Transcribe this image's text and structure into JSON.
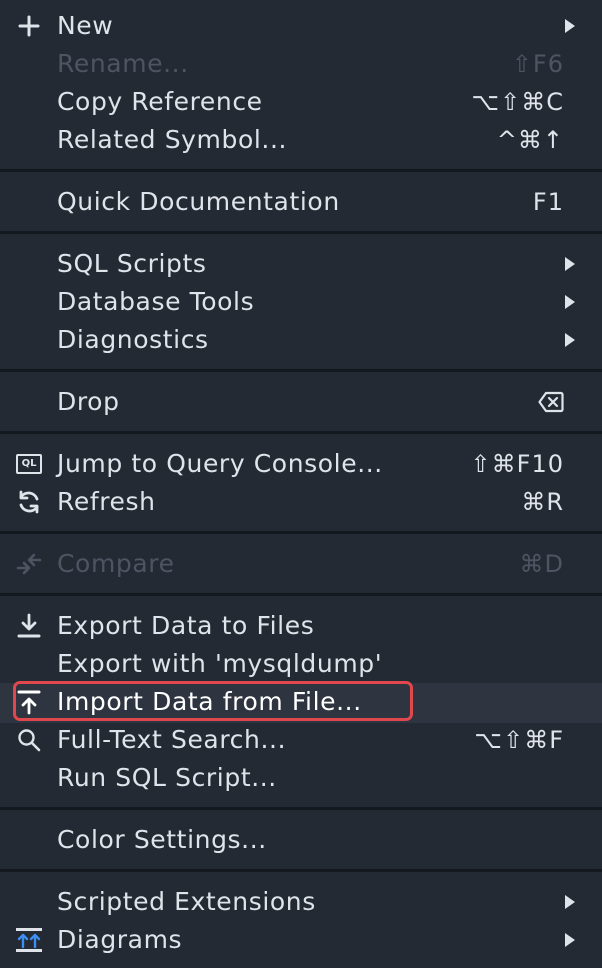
{
  "menu": {
    "new": {
      "label": "New"
    },
    "rename": {
      "label": "Rename...",
      "shortcut": "⇧F6"
    },
    "copy_reference": {
      "label": "Copy Reference",
      "shortcut": "⌥⇧⌘C"
    },
    "related_symbol": {
      "label": "Related Symbol...",
      "shortcut": "^⌘↑"
    },
    "quick_documentation": {
      "label": "Quick Documentation",
      "shortcut": "F1"
    },
    "sql_scripts": {
      "label": "SQL Scripts"
    },
    "database_tools": {
      "label": "Database Tools"
    },
    "diagnostics": {
      "label": "Diagnostics"
    },
    "drop": {
      "label": "Drop"
    },
    "jump_to_query_console": {
      "label": "Jump to Query Console...",
      "shortcut": "⇧⌘F10",
      "icon_text": "QL"
    },
    "refresh": {
      "label": "Refresh",
      "shortcut": "⌘R"
    },
    "compare": {
      "label": "Compare",
      "shortcut": "⌘D"
    },
    "export_data_to_files": {
      "label": "Export Data to Files"
    },
    "export_with_mysqldump": {
      "label": "Export with 'mysqldump'"
    },
    "import_data_from_file": {
      "label": "Import Data from File..."
    },
    "full_text_search": {
      "label": "Full-Text Search...",
      "shortcut": "⌥⇧⌘F"
    },
    "run_sql_script": {
      "label": "Run SQL Script..."
    },
    "color_settings": {
      "label": "Color Settings..."
    },
    "scripted_extensions": {
      "label": "Scripted Extensions"
    },
    "diagrams": {
      "label": "Diagrams"
    }
  },
  "colors": {
    "background": "#242a33",
    "separator": "#141920",
    "text": "#dfe3ea",
    "disabled_text": "#4d5563",
    "highlight_border": "#e0484d",
    "hover_row": "#2e3540",
    "diagram_icon_blue": "#3d8ef0"
  }
}
